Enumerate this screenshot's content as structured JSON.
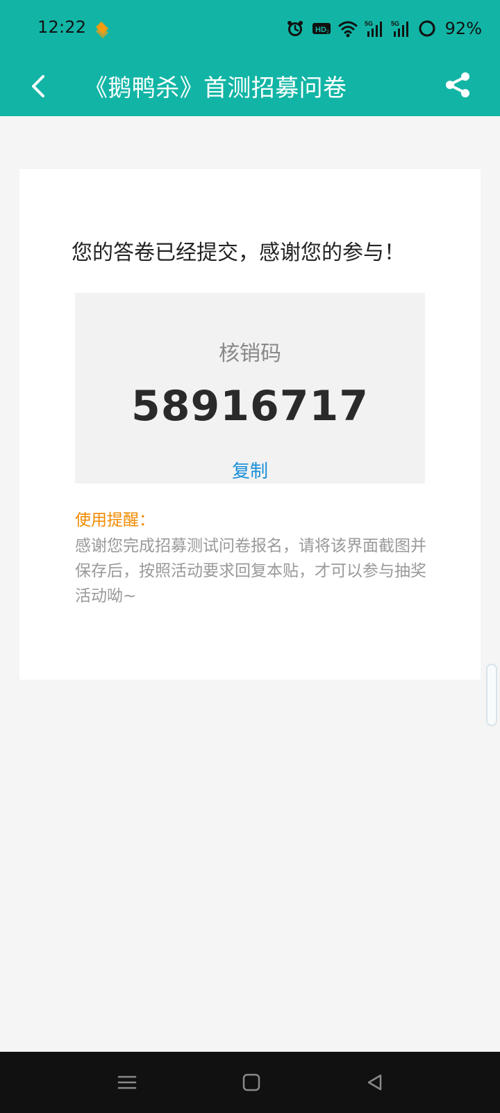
{
  "status_bar": {
    "time": "12:22",
    "battery_percent": "92%"
  },
  "header": {
    "title": "《鹅鸭杀》首测招募问卷"
  },
  "content": {
    "submitted_message": "您的答卷已经提交，感谢您的参与！",
    "code_label": "核销码",
    "code_value": "58916717",
    "copy_label": "复制",
    "reminder_title": "使用提醒：",
    "reminder_text": "感谢您完成招募测试问卷报名，请将该界面截图并保存后，按照活动要求回复本贴，才可以参与抽奖活动呦~"
  },
  "colors": {
    "header": "#12b5a5",
    "background": "#f5f5f5",
    "card": "#ffffff",
    "code_box": "#f2f2f2",
    "copy_link": "#1a8fd8",
    "reminder_title": "#f08a00",
    "reminder_text": "#999999"
  },
  "icons": {
    "back": "back-arrow-icon",
    "share": "share-icon",
    "app": "app-badge-icon",
    "alarm": "alarm-icon",
    "hd": "hd-icon",
    "wifi": "wifi-icon",
    "signal": "signal-icon",
    "battery": "battery-icon",
    "nav_menu": "menu-icon",
    "nav_home": "home-icon",
    "nav_back": "back-triangle-icon"
  }
}
